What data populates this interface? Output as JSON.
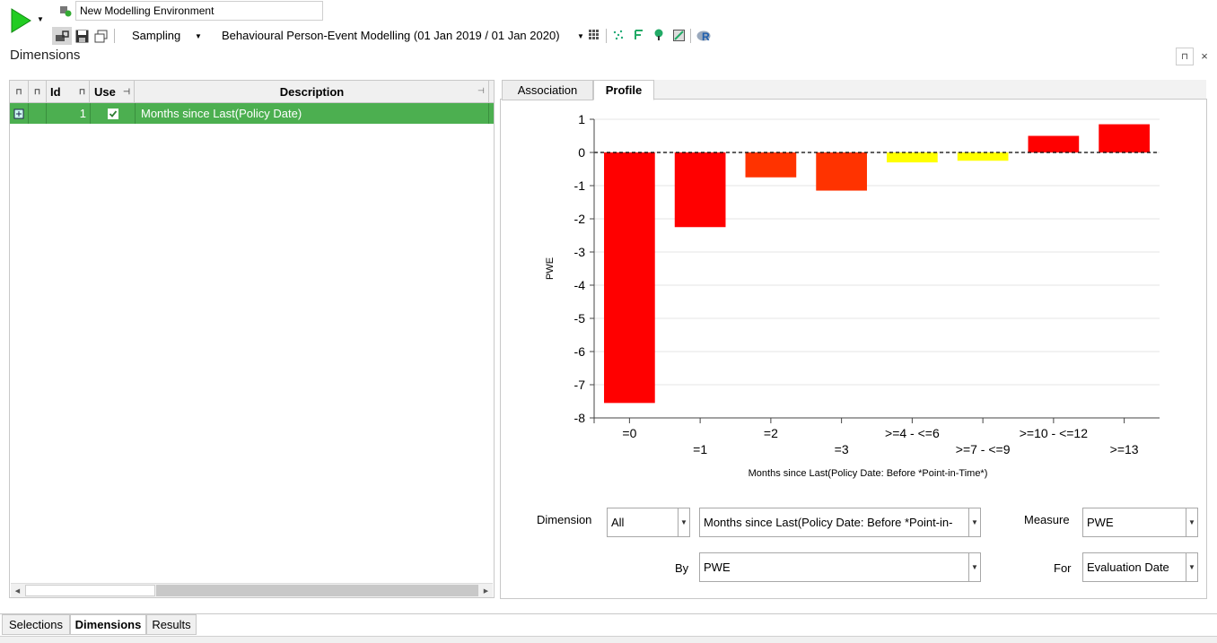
{
  "toolbar": {
    "environment_name": "New Modelling Environment",
    "sampling_label": "Sampling",
    "model_label": "Behavioural Person-Event Modelling  (01 Jan 2019 / 01 Jan 2020)",
    "r_label": "R"
  },
  "panel": {
    "title": "Dimensions",
    "pin_glyph": "⊓",
    "close_glyph": "×"
  },
  "grid": {
    "columns": [
      "Id",
      "Use",
      "Description"
    ],
    "rows": [
      {
        "id": "1",
        "use": true,
        "description": "Months since Last(Policy Date)"
      }
    ]
  },
  "tabs": [
    {
      "label": "Association",
      "active": false
    },
    {
      "label": "Profile",
      "active": true
    }
  ],
  "chart_data": {
    "type": "bar",
    "categories": [
      "=0",
      "=1",
      "=2",
      "=3",
      ">=4 - <=6",
      ">=7 - <=9",
      ">=10 - <=12",
      ">=13"
    ],
    "values": [
      -7.55,
      -2.25,
      -0.75,
      -1.15,
      -0.3,
      -0.25,
      0.5,
      0.85
    ],
    "colors": [
      "#ff0000",
      "#ff0000",
      "#ff3300",
      "#ff3300",
      "#ffff00",
      "#ffff00",
      "#ff0000",
      "#ff0000"
    ],
    "title": "",
    "xlabel": "Months since Last(Policy Date: Before *Point-in-Time*)",
    "ylabel": "PWE",
    "ylim": [
      -8,
      1
    ],
    "yticks": [
      "1",
      "0",
      "-1",
      "-2",
      "-3",
      "-4",
      "-5",
      "-6",
      "-7",
      "-8"
    ],
    "grid": true,
    "zero_line": "dashed"
  },
  "controls": {
    "dimension_label": "Dimension",
    "dimension_filter": "All",
    "dimension_value": "Months since Last(Policy Date: Before *Point-in-",
    "measure_label": "Measure",
    "measure_value": "PWE",
    "by_label": "By",
    "by_value": "PWE",
    "for_label": "For",
    "for_value": "Evaluation Date"
  },
  "bottom_tabs": [
    {
      "label": "Selections",
      "active": false
    },
    {
      "label": "Dimensions",
      "active": true
    },
    {
      "label": "Results",
      "active": false
    }
  ]
}
